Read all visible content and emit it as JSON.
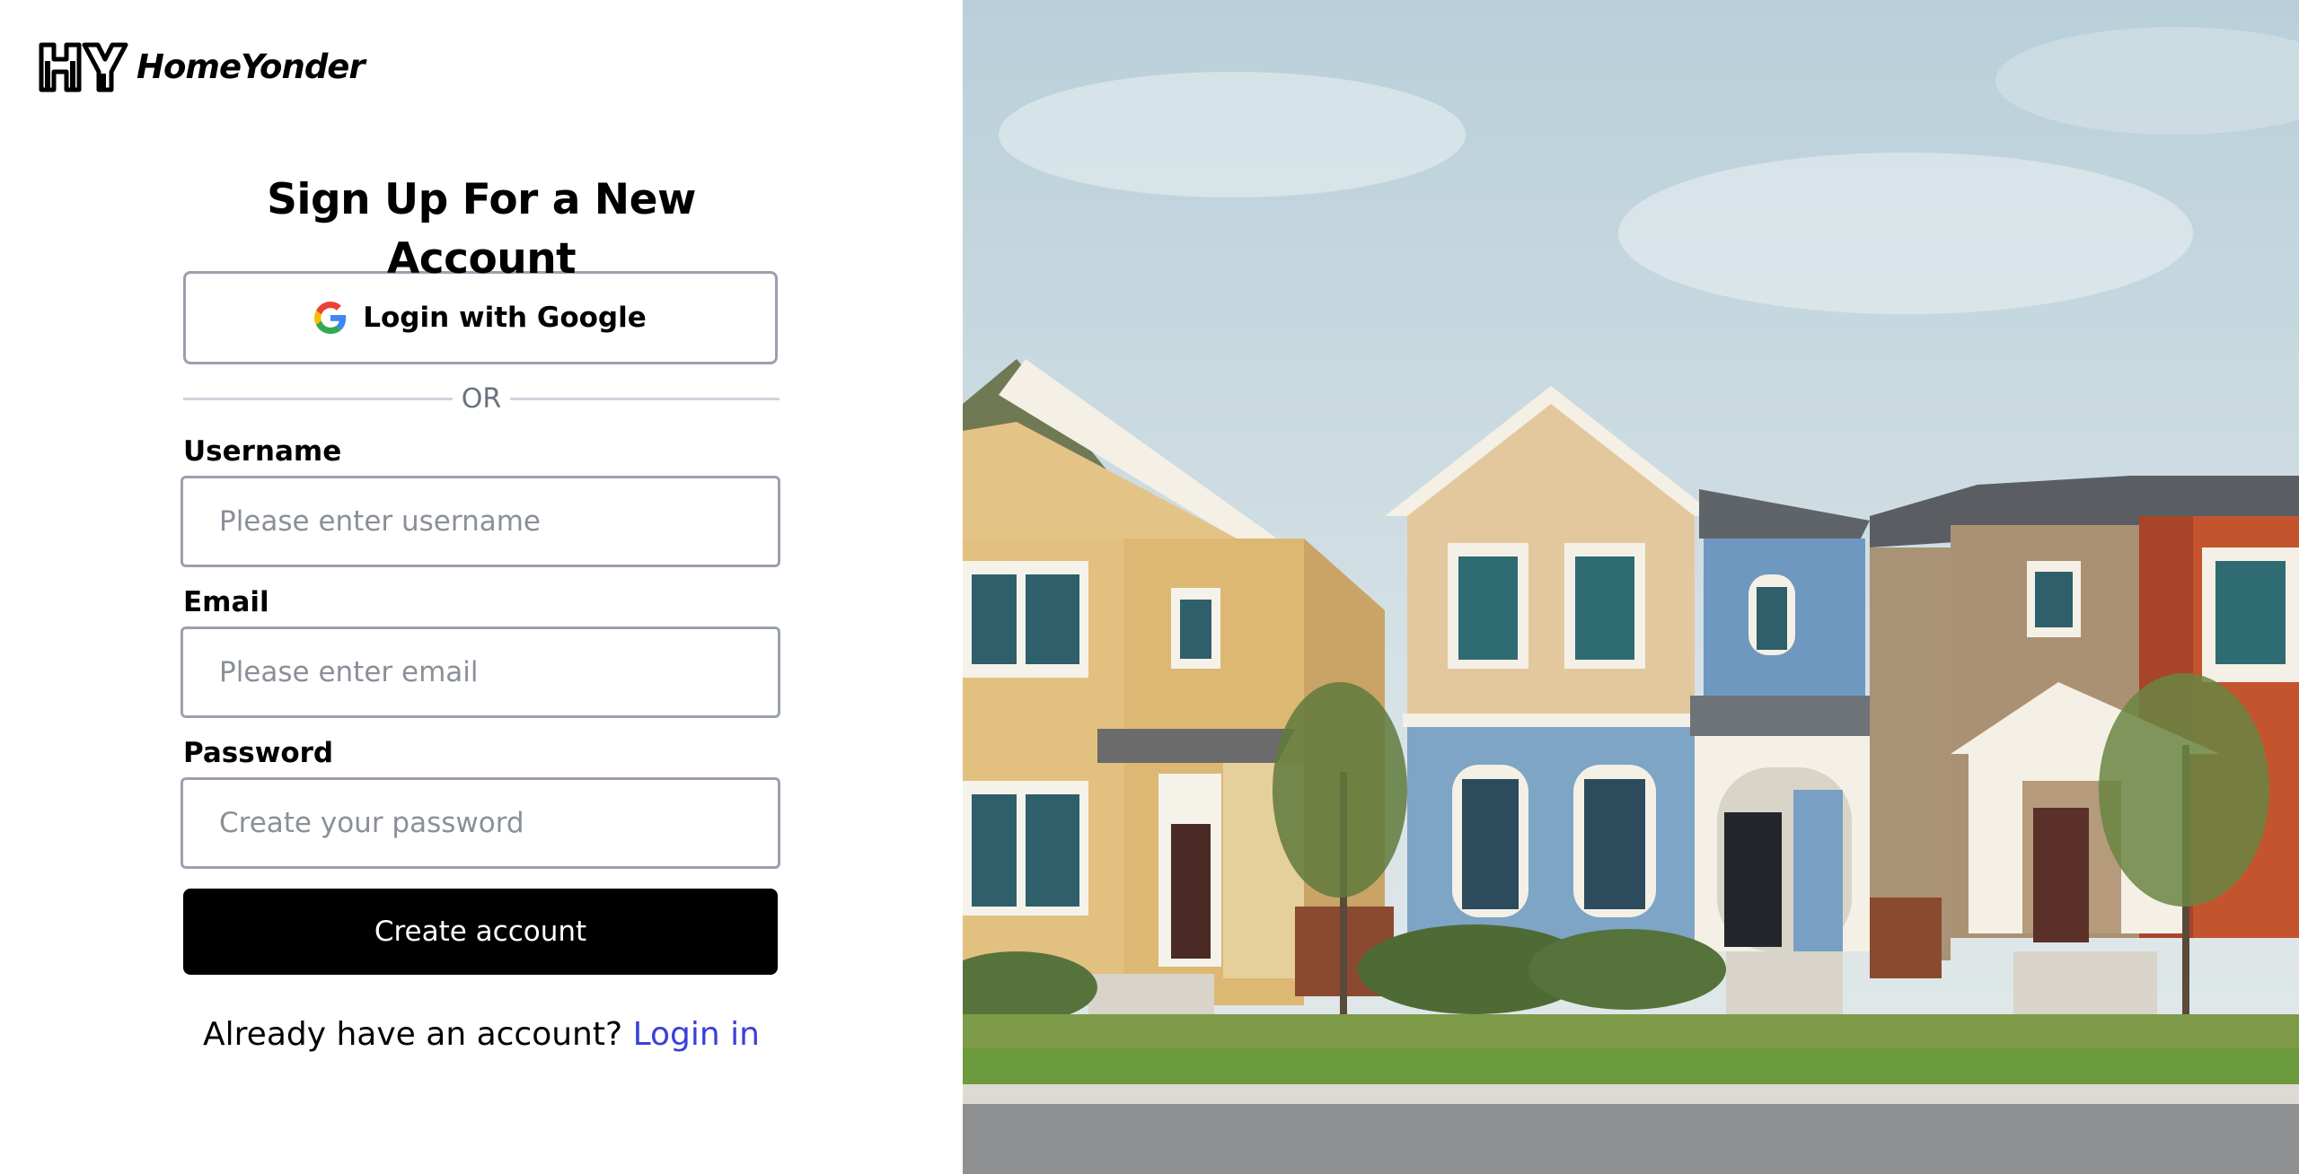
{
  "brand": {
    "name": "HomeYonder",
    "mark": "HY"
  },
  "form": {
    "title": "Sign Up For a New Account",
    "google_button": "Login with Google",
    "divider": "OR",
    "username": {
      "label": "Username",
      "placeholder": "Please enter username"
    },
    "email": {
      "label": "Email",
      "placeholder": "Please enter email"
    },
    "password": {
      "label": "Password",
      "placeholder": "Create your password"
    },
    "submit": "Create account",
    "login_prompt": "Already have an account?",
    "login_link": "Login in"
  },
  "colors": {
    "link": "#3a40d9",
    "button": "#000000",
    "border": "#9aa0ad"
  },
  "icons": [
    "google-icon"
  ]
}
